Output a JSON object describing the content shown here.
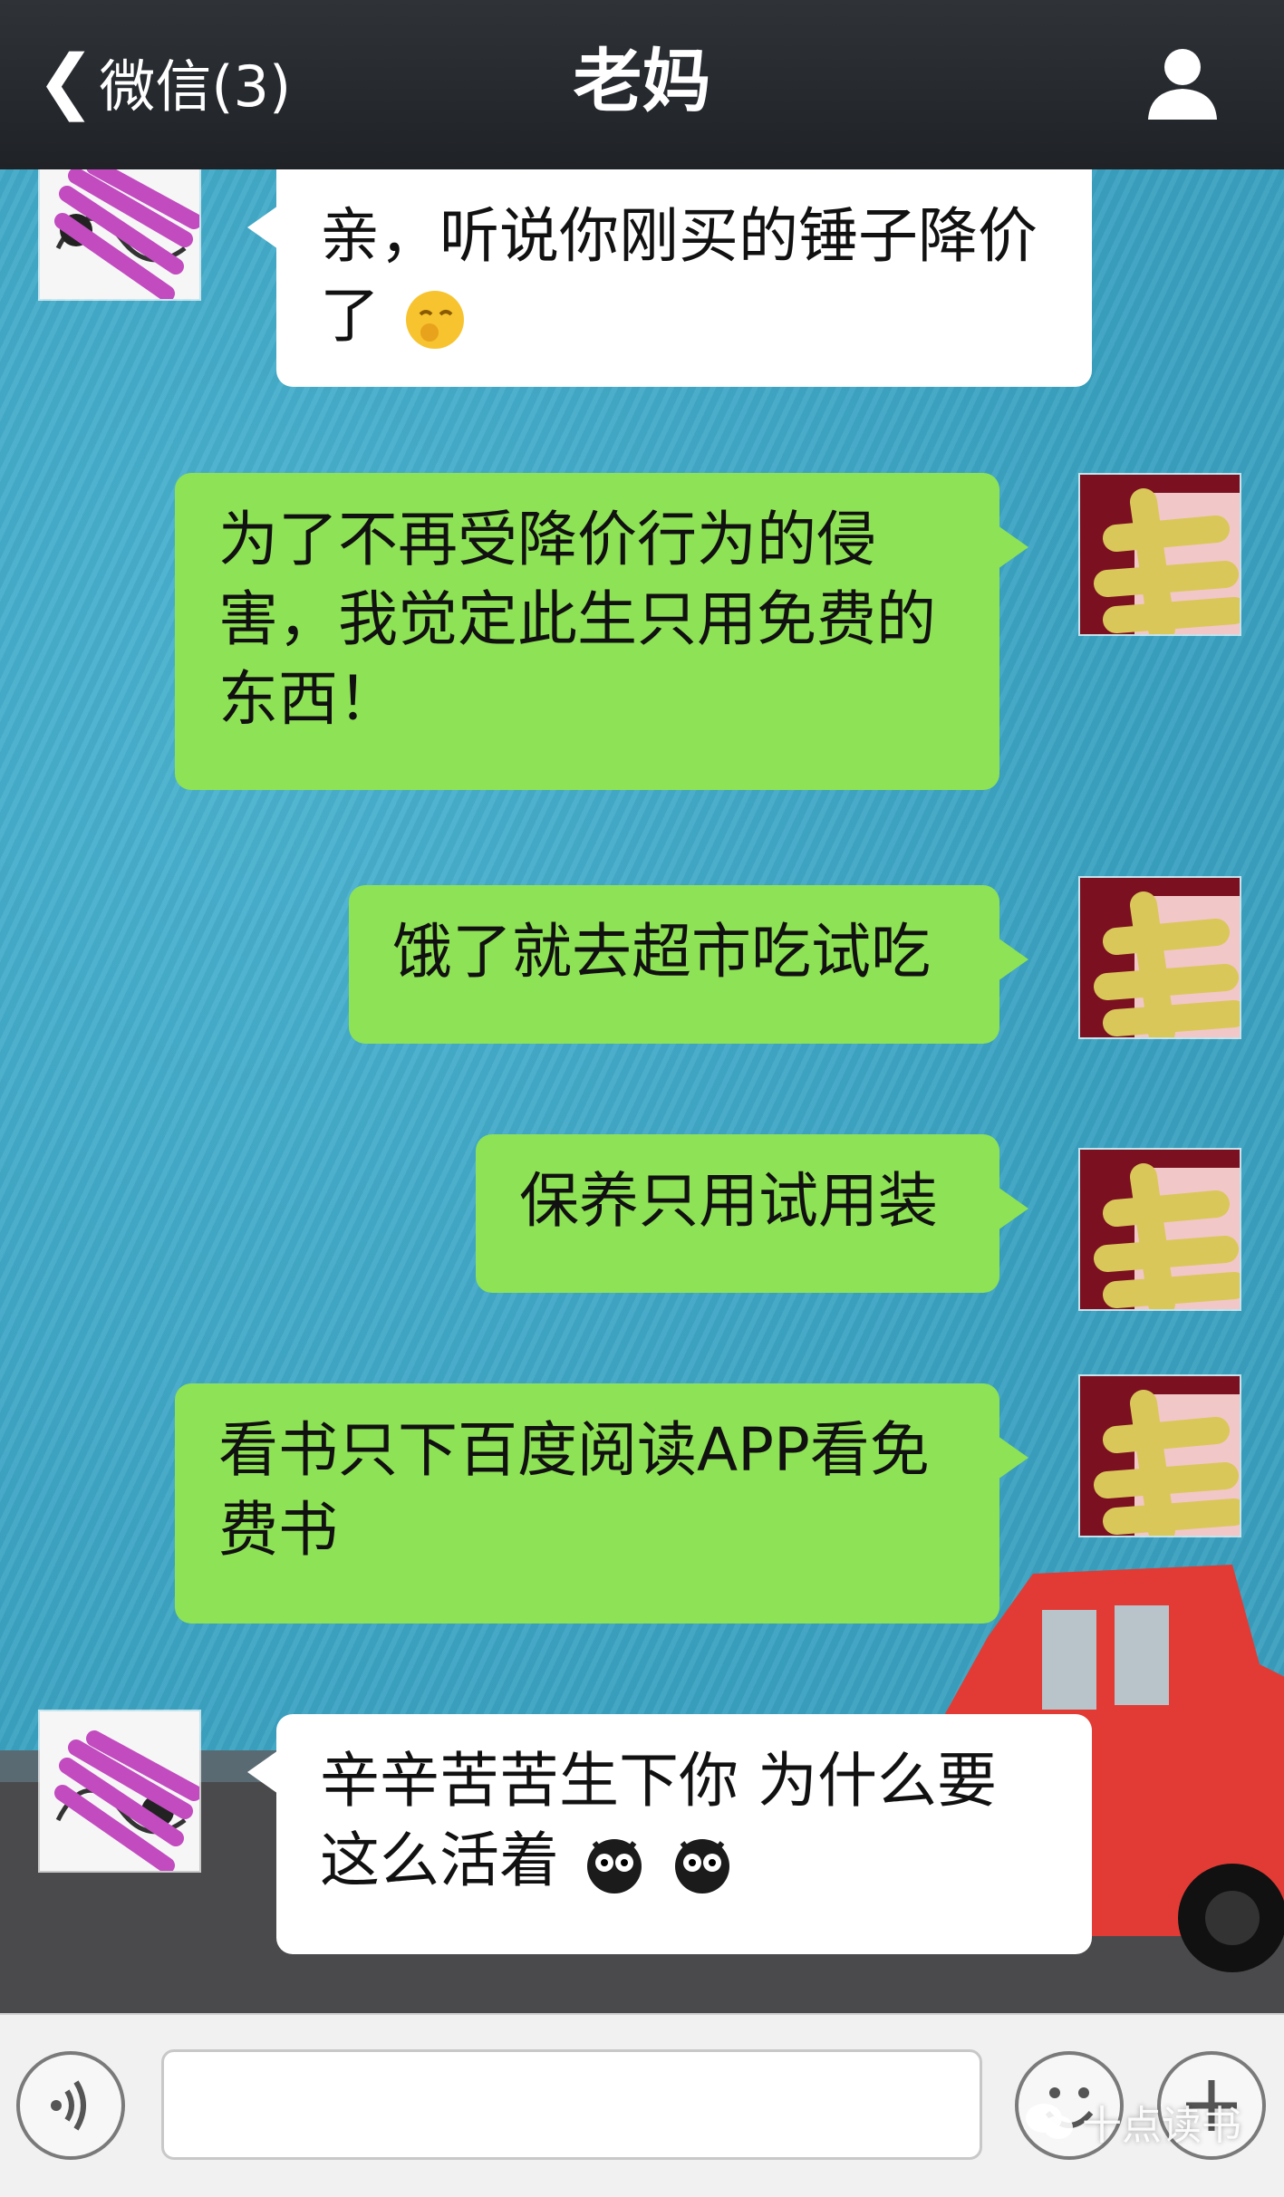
{
  "header": {
    "back_label": "微信(3)",
    "title": "老妈",
    "icons": {
      "back": "chevron-left-icon",
      "profile": "person-icon"
    }
  },
  "messages": [
    {
      "side": "left",
      "sender": "mother",
      "text": "亲，听说你刚买的锤子降价了",
      "trailing_emoji": "thinking-face-emoji"
    },
    {
      "side": "right",
      "sender": "me",
      "text": "为了不再受降价行为的侵害，我觉定此生只用免费的东西！"
    },
    {
      "side": "right",
      "sender": "me",
      "text": "饿了就去超市吃试吃"
    },
    {
      "side": "right",
      "sender": "me",
      "text": "保养只用试用装"
    },
    {
      "side": "right",
      "sender": "me",
      "text": "看书只下百度阅读APP看免费书"
    },
    {
      "side": "left",
      "sender": "mother",
      "text": "辛辛苦苦生下你 为什么要这么活着",
      "trailing_emoji": "owl-face-emoji x2"
    }
  ],
  "input": {
    "placeholder": "",
    "icons": {
      "voice": "voice-wave-icon",
      "emoji": "smiley-icon",
      "more": "plus-icon"
    }
  },
  "watermark": "十点读书",
  "colors": {
    "header_bg": "#25282c",
    "bubble_left": "#ffffff",
    "bubble_right": "#8ee255",
    "chat_bg": "#3fa7c6"
  }
}
